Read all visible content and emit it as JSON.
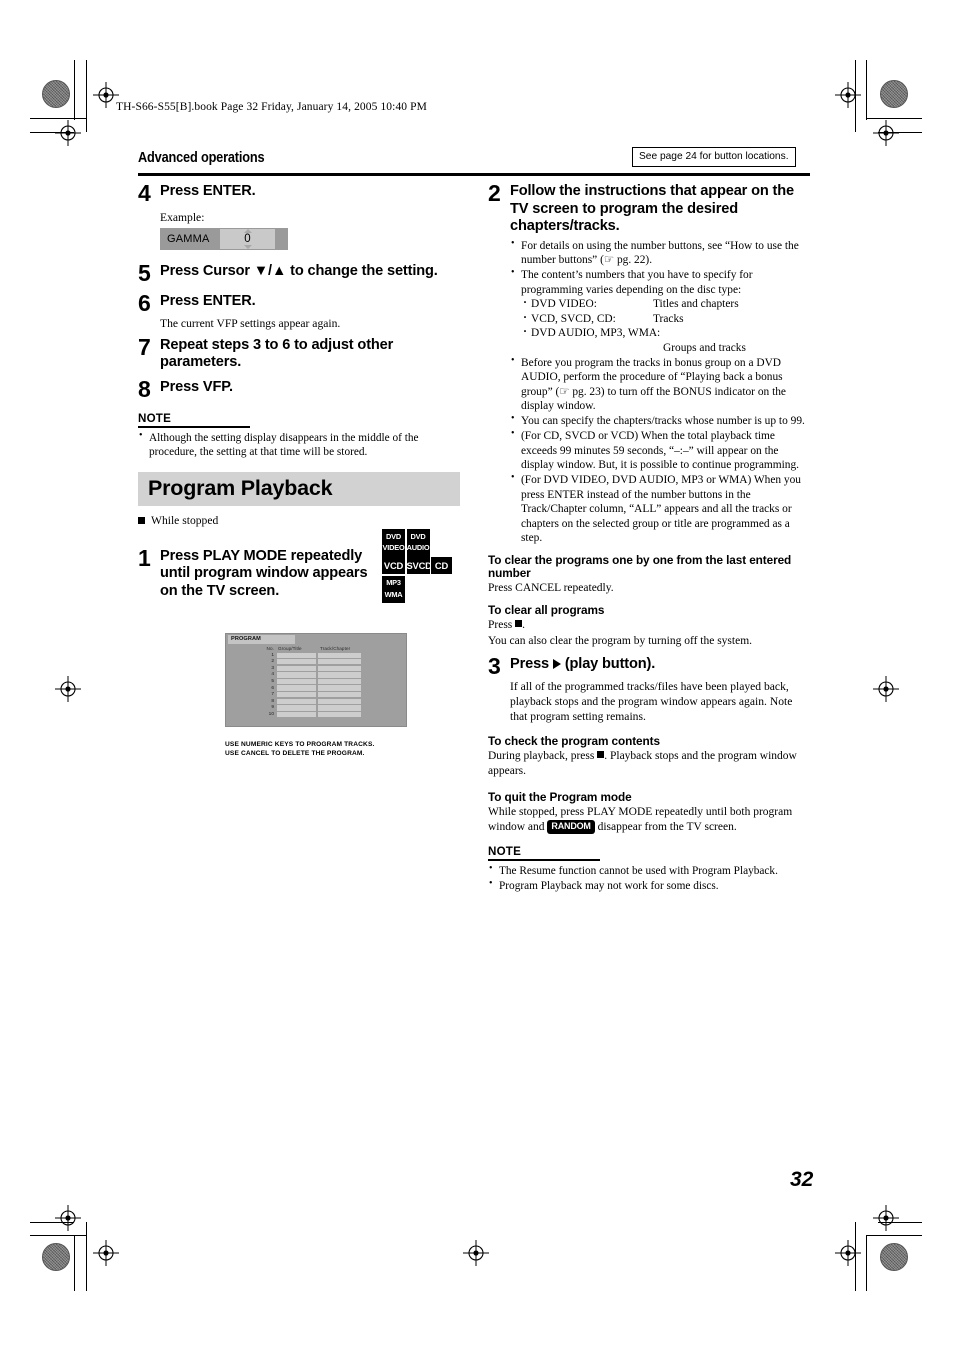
{
  "bookline": "TH-S66-S55[B].book  Page 32  Friday, January 14, 2005  10:40 PM",
  "header": {
    "title": "Advanced operations",
    "see_page_note": "See page 24 for button locations."
  },
  "page_number": "32",
  "left_column": {
    "steps": [
      {
        "num": "4",
        "text": "Press ENTER.",
        "example_label": "Example:",
        "osd": {
          "label": "GAMMA",
          "value": "0"
        }
      },
      {
        "num": "5",
        "text": "Press Cursor ▼/▲ to change the setting."
      },
      {
        "num": "6",
        "text": "Press ENTER.",
        "sub": "The current VFP settings appear again."
      },
      {
        "num": "7",
        "text": "Repeat steps 3 to 6 to adjust other parameters."
      },
      {
        "num": "8",
        "text": "Press VFP."
      }
    ],
    "note": {
      "heading": "NOTE",
      "items": [
        "Although the setting display disappears in the middle of the procedure, the setting at that time will be stored."
      ]
    },
    "section_title": "Program Playback",
    "while_stopped": "While stopped",
    "disc_badges": [
      {
        "id": "dvd-video",
        "line1": "DVD",
        "line2": "VIDEO"
      },
      {
        "id": "dvd-audio",
        "line1": "DVD",
        "line2": "AUDIO"
      },
      {
        "id": "vcd",
        "line1": "VCD"
      },
      {
        "id": "svcd",
        "line1": "SVCD"
      },
      {
        "id": "cd",
        "line1": "CD"
      },
      {
        "id": "mp3-wma",
        "line1": "MP3",
        "line2": "WMA"
      }
    ],
    "step1": {
      "num": "1",
      "text": "Press PLAY MODE repeatedly until program window appears on the TV screen."
    },
    "program_window": {
      "title": "PROGRAM",
      "columns": [
        "No.",
        "Group/Title",
        "Track/Chapter"
      ],
      "rows": [
        "1",
        "2",
        "3",
        "4",
        "5",
        "6",
        "7",
        "8",
        "9",
        "10"
      ],
      "caption_line1": "USE NUMERIC KEYS TO PROGRAM TRACKS.",
      "caption_line2": "USE CANCEL TO DELETE THE PROGRAM."
    }
  },
  "right_column": {
    "step2": {
      "num": "2",
      "text": "Follow the instructions that appear on the TV screen to program the desired chapters/tracks.",
      "bullets": [
        "For details on using the number buttons, see “How to use the number buttons” (☞ pg. 22).",
        "The content’s numbers that you have to specify for programming varies depending on the disc type:",
        "Before you program the tracks in bonus group on a DVD AUDIO, perform the procedure of “Playing back a bonus group” (☞ pg. 23) to turn off the BONUS indicator on the display window.",
        "You can specify the chapters/tracks whose number is up to 99.",
        "(For CD, SVCD or VCD) When the total playback time exceeds 99 minutes 59 seconds, “–:–” will appear on the display window. But, it is possible to continue programming.",
        "(For DVD VIDEO, DVD AUDIO, MP3 or WMA) When you press ENTER instead of the number buttons in the Track/Chapter column, “ALL” appears and all the tracks or chapters on the selected group or title are programmed as a step."
      ],
      "disc_type_table": [
        {
          "type": "DVD VIDEO:",
          "content": "Titles and chapters"
        },
        {
          "type": "VCD, SVCD, CD:",
          "content": "Tracks"
        },
        {
          "type": "DVD AUDIO, MP3, WMA:",
          "content": "Groups and tracks"
        }
      ]
    },
    "clear_one": {
      "heading": "To clear the programs one by one from the last entered number",
      "body": "Press CANCEL repeatedly."
    },
    "clear_all": {
      "heading": "To clear all programs",
      "body_prefix": "Press ",
      "body_suffix": ".",
      "extra": "You can also clear the program by turning off the system."
    },
    "step3": {
      "num": "3",
      "text_prefix": "Press ",
      "text_suffix": " (play button).",
      "sub": "If all of the programmed tracks/files have been played back, playback stops and the program window appears again. Note that program setting remains."
    },
    "check_contents": {
      "heading": "To check the program contents",
      "body_prefix": "During playback, press ",
      "body_suffix": ". Playback stops and the program window appears."
    },
    "quit_mode": {
      "heading": "To quit the Program mode",
      "body_prefix": "While stopped, press PLAY MODE repeatedly until both program window and ",
      "badge": "RANDOM",
      "body_suffix": " disappear from the TV screen."
    },
    "note": {
      "heading": "NOTE",
      "items": [
        "The Resume function cannot be used with Program Playback.",
        "Program Playback may not work for some discs."
      ]
    }
  }
}
